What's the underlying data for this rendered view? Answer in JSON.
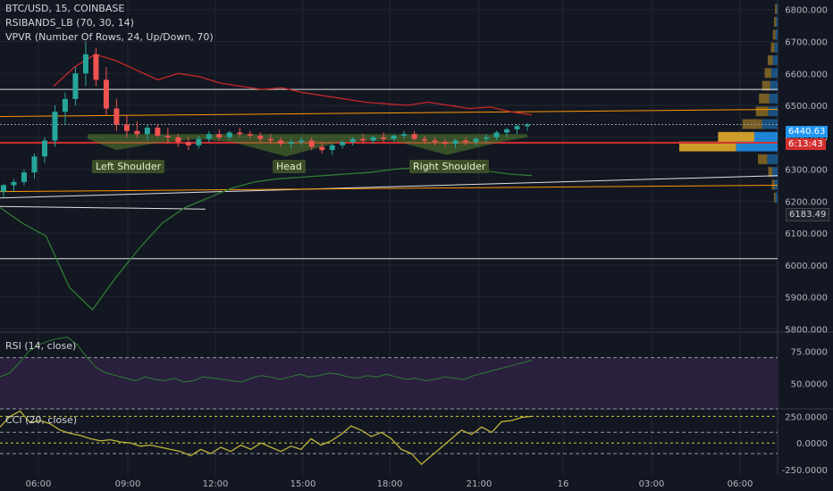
{
  "header": {
    "symbol_line": "BTC/USD, 15, COINBASE",
    "indicator1": "RSIBANDS_LB (70, 30, 14)",
    "indicator2": "VPVR (Number Of Rows, 24, Up/Down, 70)"
  },
  "panes": {
    "rsi_title": "RSI (14, close)",
    "cci_title": "CCI (20, close)"
  },
  "patterns": {
    "left": "Left Shoulder",
    "head": "Head",
    "right": "Right Shoulder"
  },
  "price_tags": {
    "last_price": "6440.63",
    "countdown": "6:13:43",
    "level": "6183.49"
  },
  "colors": {
    "bg": "#131722",
    "grid": "#232733",
    "up": "#26a69a",
    "down": "#ef5350",
    "rsi_band_red": "#c62828",
    "rsi_band_green": "#2e7d32",
    "white_line": "#e0e0e0",
    "orange_line": "#ff9800",
    "rsi_fill": "#2a1f3d",
    "cci": "#bdb33a",
    "vpvr_up": "#2196f3",
    "vpvr_down": "#f0b429"
  },
  "chart_data": [
    {
      "type": "candlestick",
      "title": "BTC/USD, 15, COINBASE",
      "x_ticks": [
        "06:00",
        "09:00",
        "12:00",
        "15:00",
        "18:00",
        "21:00",
        "16",
        "03:00",
        "06:00"
      ],
      "y_ticks": [
        5800,
        5900,
        6000,
        6100,
        6200,
        6300,
        6400,
        6500,
        6600,
        6700,
        6800
      ],
      "ylim": [
        5790,
        6830
      ],
      "candles": [
        [
          6230,
          6255,
          6210,
          6250
        ],
        [
          6250,
          6270,
          6230,
          6260
        ],
        [
          6260,
          6300,
          6250,
          6290
        ],
        [
          6290,
          6350,
          6270,
          6340
        ],
        [
          6340,
          6400,
          6320,
          6390
        ],
        [
          6390,
          6500,
          6370,
          6480
        ],
        [
          6480,
          6540,
          6440,
          6520
        ],
        [
          6520,
          6620,
          6500,
          6600
        ],
        [
          6600,
          6700,
          6560,
          6660
        ],
        [
          6660,
          6680,
          6560,
          6580
        ],
        [
          6580,
          6620,
          6470,
          6490
        ],
        [
          6490,
          6520,
          6420,
          6440
        ],
        [
          6440,
          6470,
          6400,
          6420
        ],
        [
          6420,
          6450,
          6400,
          6410
        ],
        [
          6410,
          6440,
          6390,
          6430
        ],
        [
          6430,
          6440,
          6400,
          6405
        ],
        [
          6405,
          6430,
          6380,
          6400
        ],
        [
          6400,
          6410,
          6370,
          6385
        ],
        [
          6385,
          6400,
          6360,
          6375
        ],
        [
          6375,
          6405,
          6365,
          6395
        ],
        [
          6395,
          6420,
          6385,
          6410
        ],
        [
          6410,
          6425,
          6390,
          6400
        ],
        [
          6400,
          6420,
          6390,
          6415
        ],
        [
          6415,
          6430,
          6400,
          6410
        ],
        [
          6410,
          6420,
          6395,
          6405
        ],
        [
          6405,
          6415,
          6385,
          6395
        ],
        [
          6395,
          6410,
          6380,
          6390
        ],
        [
          6390,
          6400,
          6370,
          6380
        ],
        [
          6380,
          6395,
          6365,
          6385
        ],
        [
          6385,
          6400,
          6375,
          6390
        ],
        [
          6390,
          6400,
          6360,
          6370
        ],
        [
          6370,
          6385,
          6350,
          6360
        ],
        [
          6360,
          6380,
          6345,
          6375
        ],
        [
          6375,
          6390,
          6365,
          6385
        ],
        [
          6385,
          6400,
          6375,
          6395
        ],
        [
          6395,
          6410,
          6380,
          6390
        ],
        [
          6390,
          6405,
          6380,
          6400
        ],
        [
          6400,
          6415,
          6385,
          6395
        ],
        [
          6395,
          6410,
          6385,
          6405
        ],
        [
          6405,
          6420,
          6395,
          6410
        ],
        [
          6410,
          6420,
          6390,
          6395
        ],
        [
          6395,
          6405,
          6380,
          6390
        ],
        [
          6390,
          6400,
          6375,
          6385
        ],
        [
          6385,
          6395,
          6370,
          6380
        ],
        [
          6380,
          6395,
          6365,
          6390
        ],
        [
          6390,
          6400,
          6375,
          6385
        ],
        [
          6385,
          6400,
          6375,
          6395
        ],
        [
          6395,
          6410,
          6385,
          6400
        ],
        [
          6400,
          6420,
          6390,
          6415
        ],
        [
          6415,
          6430,
          6400,
          6425
        ],
        [
          6425,
          6440,
          6410,
          6435
        ],
        [
          6435,
          6445,
          6420,
          6440
        ]
      ],
      "rsi_band_upper": [
        6560,
        6620,
        6660,
        6640,
        6610,
        6580,
        6600,
        6590,
        6570,
        6560,
        6550,
        6555,
        6540,
        6530,
        6520,
        6510,
        6505,
        6500,
        6510,
        6500,
        6490,
        6495,
        6480,
        6470
      ],
      "rsi_band_lower": [
        6180,
        6130,
        6090,
        5930,
        5860,
        5960,
        6050,
        6130,
        6180,
        6210,
        6240,
        6260,
        6270,
        6275,
        6280,
        6285,
        6290,
        6300,
        6305,
        6300,
        6290,
        6295,
        6285,
        6280
      ],
      "horizontal_levels": {
        "white": [
          6550,
          6440,
          6183.49,
          6020
        ],
        "red": 6383,
        "orange": 6465
      },
      "vpvr": [
        {
          "price": 6800,
          "up": 2,
          "down": 3
        },
        {
          "price": 6760,
          "up": 3,
          "down": 4
        },
        {
          "price": 6720,
          "up": 4,
          "down": 5
        },
        {
          "price": 6680,
          "up": 6,
          "down": 7
        },
        {
          "price": 6640,
          "up": 9,
          "down": 10
        },
        {
          "price": 6600,
          "up": 12,
          "down": 13
        },
        {
          "price": 6560,
          "up": 14,
          "down": 16
        },
        {
          "price": 6520,
          "up": 16,
          "down": 20
        },
        {
          "price": 6480,
          "up": 18,
          "down": 24
        },
        {
          "price": 6440,
          "up": 30,
          "down": 38
        },
        {
          "price": 6400,
          "up": 45,
          "down": 70
        },
        {
          "price": 6370,
          "up": 80,
          "down": 110
        },
        {
          "price": 6330,
          "up": 20,
          "down": 18
        },
        {
          "price": 6290,
          "up": 10,
          "down": 8
        },
        {
          "price": 6250,
          "up": 6,
          "down": 5
        },
        {
          "price": 6210,
          "up": 4,
          "down": 3
        }
      ]
    },
    {
      "type": "line",
      "title": "RSI (14, close)",
      "y_ticks": [
        75.0,
        50.0
      ],
      "ylim": [
        30,
        90
      ],
      "bands": [
        70,
        30
      ],
      "values": [
        55,
        58,
        66,
        75,
        80,
        83,
        85,
        86,
        80,
        70,
        62,
        58,
        56,
        54,
        52,
        55,
        53,
        52,
        54,
        51,
        52,
        55,
        54,
        53,
        52,
        51,
        54,
        56,
        55,
        53,
        55,
        57,
        55,
        56,
        58,
        57,
        55,
        54,
        56,
        55,
        57,
        55,
        53,
        54,
        52,
        53,
        55,
        54,
        53,
        56,
        58,
        60,
        62,
        64,
        66,
        68
      ]
    },
    {
      "type": "line",
      "title": "CCI (20, close)",
      "y_ticks": [
        250.0,
        0.0,
        -250.0
      ],
      "ylim": [
        -300,
        320
      ],
      "values": [
        150,
        250,
        300,
        190,
        210,
        180,
        120,
        90,
        70,
        40,
        20,
        30,
        10,
        0,
        -30,
        -20,
        -40,
        -60,
        -80,
        -120,
        -60,
        -100,
        -40,
        -80,
        -20,
        -60,
        0,
        -40,
        -80,
        -30,
        -60,
        40,
        -20,
        20,
        80,
        160,
        120,
        60,
        100,
        40,
        -60,
        -100,
        -200,
        -120,
        -40,
        40,
        120,
        80,
        150,
        100,
        200,
        210,
        240,
        250
      ]
    }
  ]
}
